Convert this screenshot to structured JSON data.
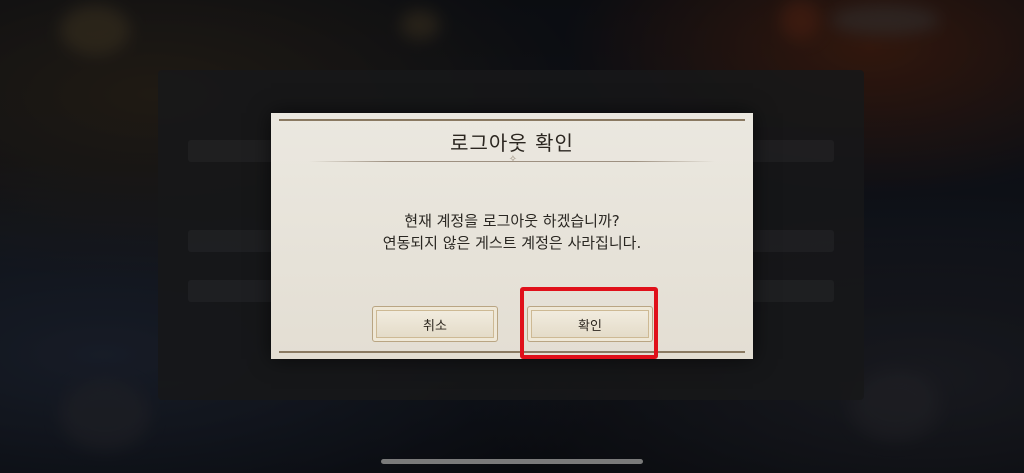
{
  "dialog": {
    "title": "로그아웃 확인",
    "message_line1": "현재 계정을 로그아웃 하겠습니까?",
    "message_line2": "연동되지 않은 게스트 계정은 사라집니다.",
    "cancel_label": "취소",
    "confirm_label": "확인"
  },
  "colors": {
    "highlight": "#e0101a",
    "dialog_bg": "#e8e4db"
  }
}
